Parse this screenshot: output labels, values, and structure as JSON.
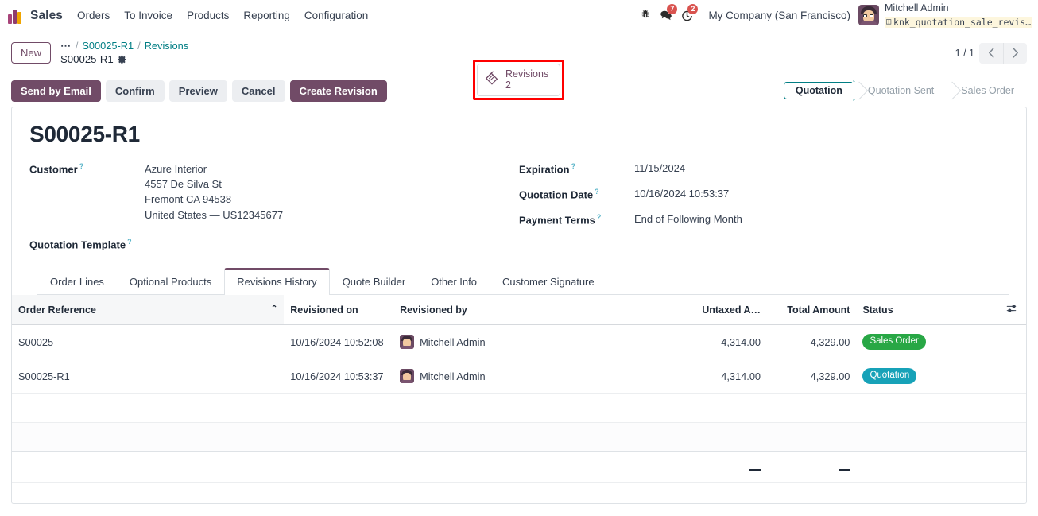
{
  "navbar": {
    "app_name": "Sales",
    "menu": [
      "Orders",
      "To Invoice",
      "Products",
      "Reporting",
      "Configuration"
    ],
    "bug_icon": "bug-icon",
    "messages_icon": "messages-icon",
    "messages_count": "7",
    "activities_icon": "activities-clock-icon",
    "activities_count": "2",
    "company": "My Company (San Francisco)",
    "user_name": "Mitchell Admin",
    "database": "knk_quotation_sale_revis…",
    "database_icon": "database-icon"
  },
  "control_panel": {
    "new_label": "New",
    "breadcrumb_dots": "⋯",
    "breadcrumb_sep": "/",
    "breadcrumb_parent": "S00025-R1",
    "breadcrumb_child": "Revisions",
    "record_name": "S00025-R1",
    "gear_icon": "gear-icon",
    "stat_button": {
      "icon": "revisions-tag-icon",
      "label": "Revisions",
      "value": "2"
    },
    "pager": {
      "count": "1 / 1",
      "prev_icon": "chevron-left-icon",
      "next_icon": "chevron-right-icon"
    }
  },
  "actions": {
    "send_by_email": "Send by Email",
    "confirm": "Confirm",
    "preview": "Preview",
    "cancel": "Cancel",
    "create_revision": "Create Revision"
  },
  "statusbar": {
    "states": [
      "Quotation",
      "Quotation Sent",
      "Sales Order"
    ],
    "active": "Quotation"
  },
  "record": {
    "title": "S00025-R1",
    "left_fields": [
      {
        "label": "Customer",
        "help": "?",
        "lines": [
          "Azure Interior",
          "4557 De Silva St",
          "Fremont CA 94538",
          "United States — US12345677"
        ]
      },
      {
        "label": "Quotation Template",
        "help": "?",
        "lines": [
          ""
        ]
      }
    ],
    "right_fields": [
      {
        "label": "Expiration",
        "help": "?",
        "lines": [
          "11/15/2024"
        ]
      },
      {
        "label": "Quotation Date",
        "help": "?",
        "lines": [
          "10/16/2024 10:53:37"
        ]
      },
      {
        "label": "Payment Terms",
        "help": "?",
        "lines": [
          "End of Following Month"
        ]
      }
    ]
  },
  "notebook": {
    "tabs": [
      {
        "label": "Order Lines",
        "active": false
      },
      {
        "label": "Optional Products",
        "active": false
      },
      {
        "label": "Revisions History",
        "active": true
      },
      {
        "label": "Quote Builder",
        "active": false
      },
      {
        "label": "Other Info",
        "active": false
      },
      {
        "label": "Customer Signature",
        "active": false
      }
    ]
  },
  "table": {
    "columns": [
      {
        "label": "Order Reference",
        "align": "left",
        "sorted": true,
        "sort_caret": "⌃"
      },
      {
        "label": "Revisioned on",
        "align": "left",
        "sorted": false
      },
      {
        "label": "Revisioned by",
        "align": "left",
        "sorted": false
      },
      {
        "label": "Untaxed A…",
        "align": "right",
        "sorted": false
      },
      {
        "label": "Total Amount",
        "align": "right",
        "sorted": false
      },
      {
        "label": "Status",
        "align": "left",
        "sorted": false
      }
    ],
    "optional_columns_icon": "sliders-icon",
    "rows": [
      {
        "order_reference": "S00025",
        "revisioned_on": "10/16/2024 10:52:08",
        "revisioned_by": "Mitchell Admin",
        "untaxed_amount": "4,314.00",
        "total_amount": "4,329.00",
        "status": "Sales Order",
        "status_style": "success"
      },
      {
        "order_reference": "S00025-R1",
        "revisioned_on": "10/16/2024 10:53:37",
        "revisioned_by": "Mitchell Admin",
        "untaxed_amount": "4,314.00",
        "total_amount": "4,329.00",
        "status": "Quotation",
        "status_style": "info"
      }
    ],
    "footer": {
      "untaxed_amount": "—",
      "total_amount": "—"
    }
  },
  "colors": {
    "primary": "#714b67",
    "accent_teal": "#017e84",
    "link": "#017e84",
    "badge_success": "#28a745",
    "badge_info": "#17a2b8",
    "annotation": "#ff0000"
  }
}
